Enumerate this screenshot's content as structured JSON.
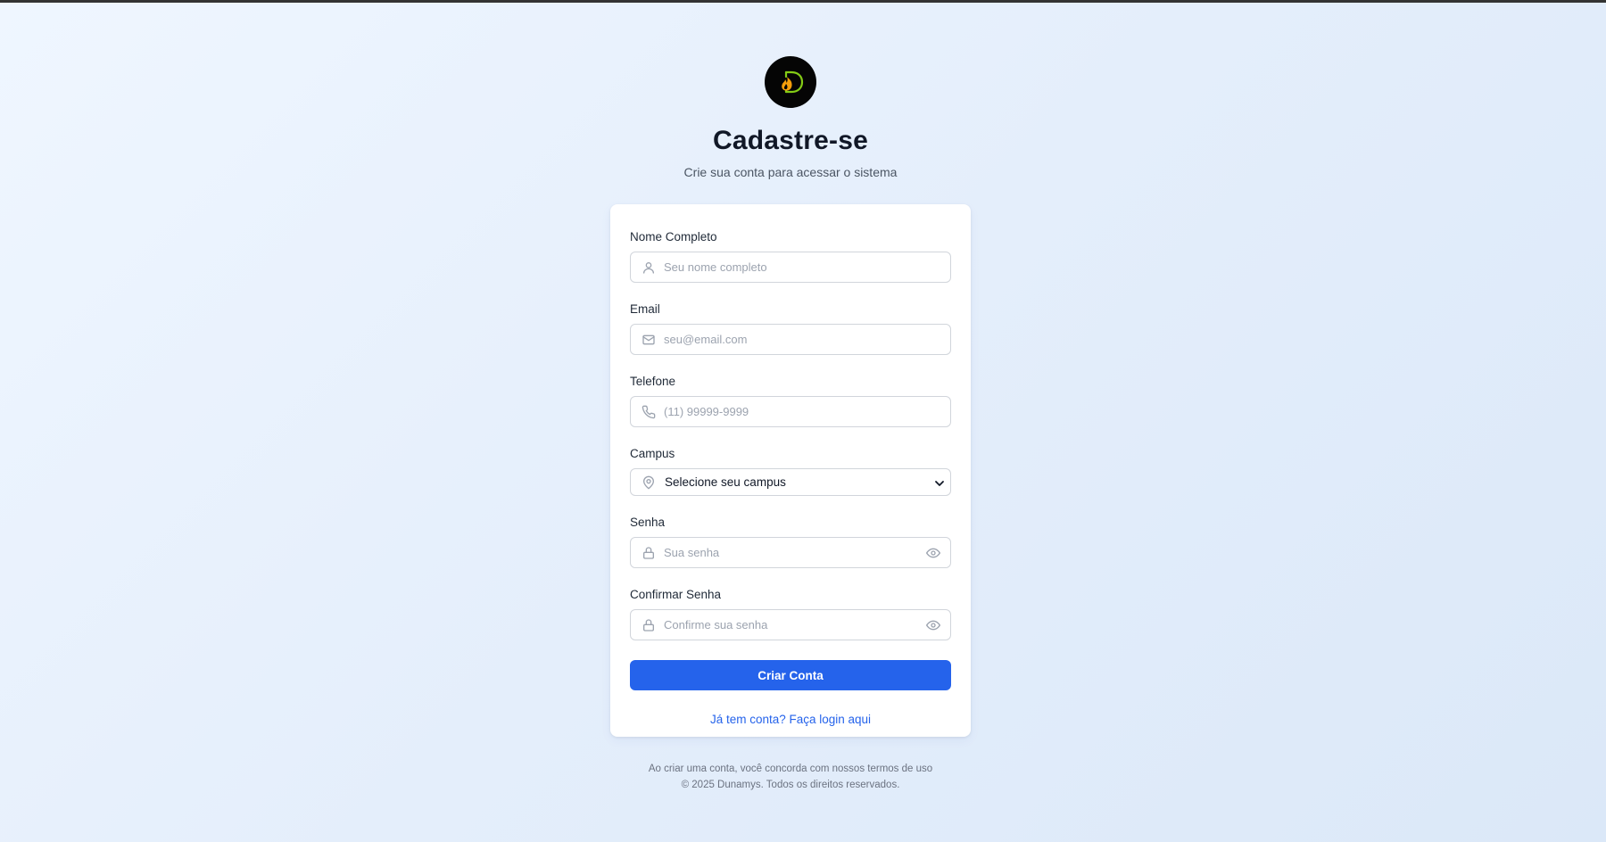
{
  "page": {
    "title": "Cadastre-se",
    "subtitle": "Crie sua conta para acessar o sistema"
  },
  "logo": {
    "icon": "dunamys-flame-logo-icon",
    "background": "#050505",
    "accent": "#84cc16",
    "flame": "#f59e0b"
  },
  "form": {
    "name": {
      "label": "Nome Completo",
      "placeholder": "Seu nome completo",
      "value": "",
      "icon": "user-icon"
    },
    "email": {
      "label": "Email",
      "placeholder": "seu@email.com",
      "value": "",
      "icon": "mail-icon"
    },
    "phone": {
      "label": "Telefone",
      "placeholder": "(11) 99999-9999",
      "value": "",
      "icon": "phone-icon"
    },
    "campus": {
      "label": "Campus",
      "selected": "Selecione seu campus",
      "icon": "map-pin-icon"
    },
    "password": {
      "label": "Senha",
      "placeholder": "Sua senha",
      "value": "",
      "icon": "lock-icon",
      "toggle_icon": "eye-icon"
    },
    "confirm_password": {
      "label": "Confirmar Senha",
      "placeholder": "Confirme sua senha",
      "value": "",
      "icon": "lock-icon",
      "toggle_icon": "eye-icon"
    },
    "submit_label": "Criar Conta",
    "login_link": "Já tem conta? Faça login aqui"
  },
  "footer": {
    "terms": "Ao criar uma conta, você concorda com nossos termos de uso",
    "copyright": "© 2025 Dunamys. Todos os direitos reservados."
  },
  "colors": {
    "primary": "#2563eb",
    "background_start": "#eff6ff",
    "background_end": "#dbe8f8",
    "icon_gray": "#9ca3af"
  }
}
